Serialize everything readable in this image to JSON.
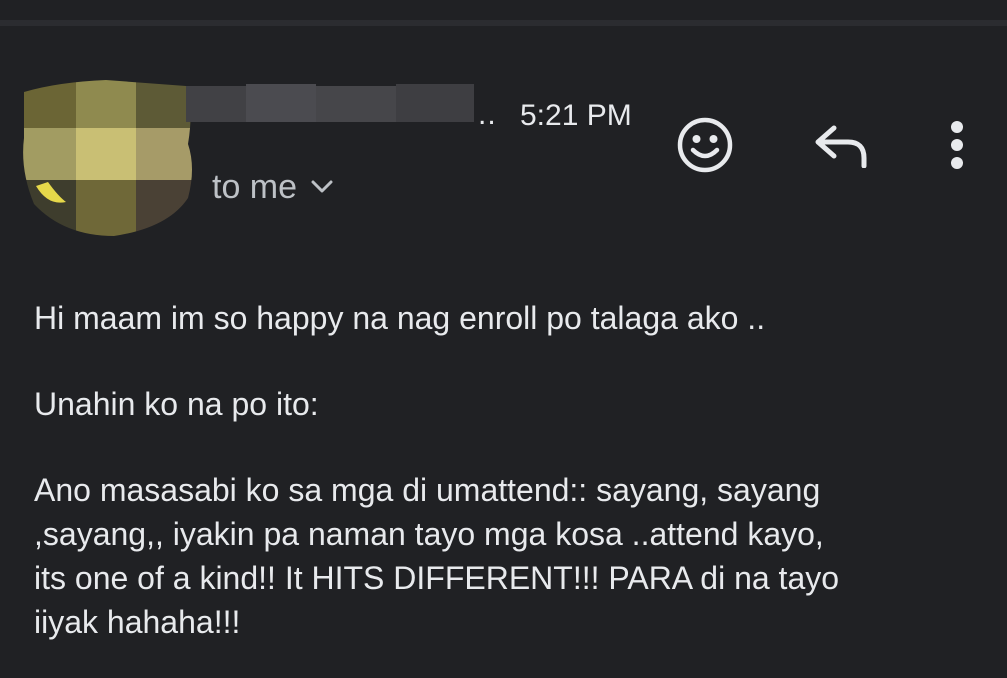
{
  "message": {
    "time": "5:21 PM",
    "ellipsis": "..",
    "recipient_label": "to me",
    "body": {
      "greeting": "Hi maam im so happy na nag enroll po talaga ako ..",
      "intro": "Unahin ko na po ito:",
      "main": "Ano masasabi ko sa mga di umattend:: sayang, sayang\n,sayang,, iyakin pa naman tayo mga kosa ..attend kayo,\nits one of a kind!! It HITS DIFFERENT!!! PARA di na tayo\niiyak hahaha!!!"
    }
  },
  "actions": {
    "emoji_icon": "smiley-icon",
    "reply_icon": "reply-arrow-icon",
    "more_icon": "vertical-dots-icon",
    "expand_icon": "chevron-down-icon"
  },
  "colors": {
    "background": "#202124",
    "text": "#e8eaed",
    "secondary_text": "#bdc1c6"
  }
}
